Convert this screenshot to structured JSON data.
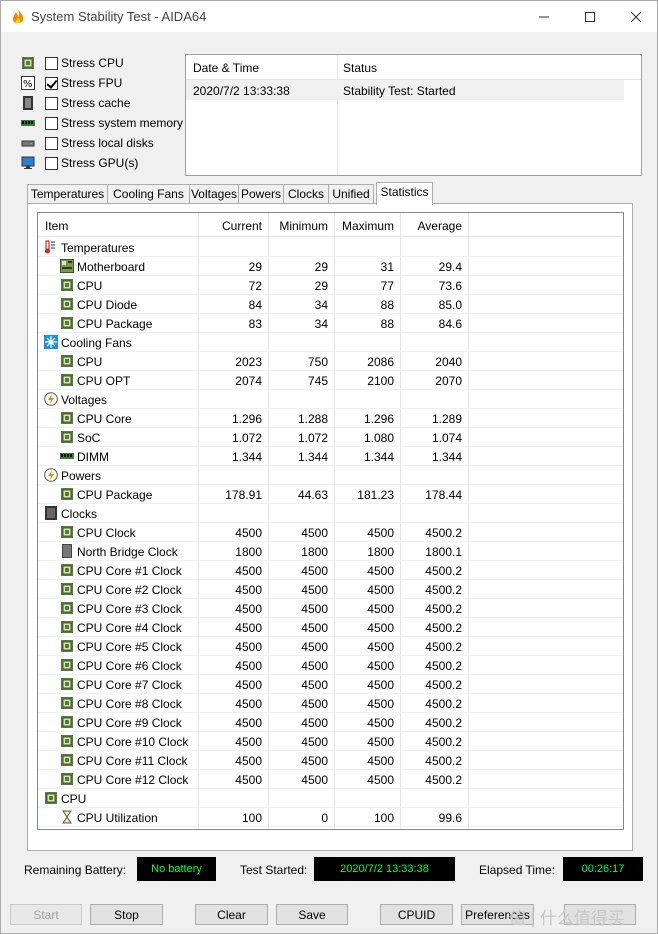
{
  "window": {
    "title": "System Stability Test - AIDA64",
    "controls": {
      "minimize": "—",
      "maximize": "☐",
      "close": "✕"
    }
  },
  "stress_options": [
    {
      "label": "Stress CPU",
      "checked": false,
      "icon": "cpu-chip-icon"
    },
    {
      "label": "Stress FPU",
      "checked": true,
      "icon": "fpu-icon"
    },
    {
      "label": "Stress cache",
      "checked": false,
      "icon": "cache-icon"
    },
    {
      "label": "Stress system memory",
      "checked": false,
      "icon": "memory-icon"
    },
    {
      "label": "Stress local disks",
      "checked": false,
      "icon": "disk-icon"
    },
    {
      "label": "Stress GPU(s)",
      "checked": false,
      "icon": "monitor-icon"
    }
  ],
  "status": {
    "headers": [
      "Date & Time",
      "Status"
    ],
    "rows": [
      [
        "2020/7/2 13:33:38",
        "Stability Test: Started"
      ]
    ]
  },
  "tabs": [
    "Temperatures",
    "Cooling Fans",
    "Voltages",
    "Powers",
    "Clocks",
    "Unified",
    "Statistics"
  ],
  "active_tab": "Statistics",
  "statistics": {
    "headers": [
      "Item",
      "Current",
      "Minimum",
      "Maximum",
      "Average"
    ],
    "rows": [
      {
        "type": "group",
        "name": "Temperatures",
        "icon": "thermometer-icon"
      },
      {
        "type": "item",
        "name": "Motherboard",
        "icon": "motherboard-icon",
        "cur": "29",
        "min": "29",
        "max": "31",
        "avg": "29.4"
      },
      {
        "type": "item",
        "name": "CPU",
        "icon": "cpu-chip-icon",
        "cur": "72",
        "min": "29",
        "max": "77",
        "avg": "73.6"
      },
      {
        "type": "item",
        "name": "CPU Diode",
        "icon": "cpu-chip-icon",
        "cur": "84",
        "min": "34",
        "max": "88",
        "avg": "85.0"
      },
      {
        "type": "item",
        "name": "CPU Package",
        "icon": "cpu-chip-icon",
        "cur": "83",
        "min": "34",
        "max": "88",
        "avg": "84.6"
      },
      {
        "type": "group",
        "name": "Cooling Fans",
        "icon": "fan-icon"
      },
      {
        "type": "item",
        "name": "CPU",
        "icon": "cpu-chip-icon",
        "cur": "2023",
        "min": "750",
        "max": "2086",
        "avg": "2040"
      },
      {
        "type": "item",
        "name": "CPU OPT",
        "icon": "cpu-chip-icon",
        "cur": "2074",
        "min": "745",
        "max": "2100",
        "avg": "2070"
      },
      {
        "type": "group",
        "name": "Voltages",
        "icon": "lightning-icon"
      },
      {
        "type": "item",
        "name": "CPU Core",
        "icon": "cpu-chip-icon",
        "cur": "1.296",
        "min": "1.288",
        "max": "1.296",
        "avg": "1.289"
      },
      {
        "type": "item",
        "name": "SoC",
        "icon": "cpu-chip-icon",
        "cur": "1.072",
        "min": "1.072",
        "max": "1.080",
        "avg": "1.074"
      },
      {
        "type": "item",
        "name": "DIMM",
        "icon": "memory-icon",
        "cur": "1.344",
        "min": "1.344",
        "max": "1.344",
        "avg": "1.344"
      },
      {
        "type": "group",
        "name": "Powers",
        "icon": "lightning-icon"
      },
      {
        "type": "item",
        "name": "CPU Package",
        "icon": "cpu-chip-icon",
        "cur": "178.91",
        "min": "44.63",
        "max": "181.23",
        "avg": "178.44"
      },
      {
        "type": "group",
        "name": "Clocks",
        "icon": "clock-chip-icon"
      },
      {
        "type": "item",
        "name": "CPU Clock",
        "icon": "cpu-chip-icon",
        "cur": "4500",
        "min": "4500",
        "max": "4500",
        "avg": "4500.2"
      },
      {
        "type": "item",
        "name": "North Bridge Clock",
        "icon": "northbridge-icon",
        "cur": "1800",
        "min": "1800",
        "max": "1800",
        "avg": "1800.1"
      },
      {
        "type": "item",
        "name": "CPU Core #1 Clock",
        "icon": "cpu-chip-icon",
        "cur": "4500",
        "min": "4500",
        "max": "4500",
        "avg": "4500.2"
      },
      {
        "type": "item",
        "name": "CPU Core #2 Clock",
        "icon": "cpu-chip-icon",
        "cur": "4500",
        "min": "4500",
        "max": "4500",
        "avg": "4500.2"
      },
      {
        "type": "item",
        "name": "CPU Core #3 Clock",
        "icon": "cpu-chip-icon",
        "cur": "4500",
        "min": "4500",
        "max": "4500",
        "avg": "4500.2"
      },
      {
        "type": "item",
        "name": "CPU Core #4 Clock",
        "icon": "cpu-chip-icon",
        "cur": "4500",
        "min": "4500",
        "max": "4500",
        "avg": "4500.2"
      },
      {
        "type": "item",
        "name": "CPU Core #5 Clock",
        "icon": "cpu-chip-icon",
        "cur": "4500",
        "min": "4500",
        "max": "4500",
        "avg": "4500.2"
      },
      {
        "type": "item",
        "name": "CPU Core #6 Clock",
        "icon": "cpu-chip-icon",
        "cur": "4500",
        "min": "4500",
        "max": "4500",
        "avg": "4500.2"
      },
      {
        "type": "item",
        "name": "CPU Core #7 Clock",
        "icon": "cpu-chip-icon",
        "cur": "4500",
        "min": "4500",
        "max": "4500",
        "avg": "4500.2"
      },
      {
        "type": "item",
        "name": "CPU Core #8 Clock",
        "icon": "cpu-chip-icon",
        "cur": "4500",
        "min": "4500",
        "max": "4500",
        "avg": "4500.2"
      },
      {
        "type": "item",
        "name": "CPU Core #9 Clock",
        "icon": "cpu-chip-icon",
        "cur": "4500",
        "min": "4500",
        "max": "4500",
        "avg": "4500.2"
      },
      {
        "type": "item",
        "name": "CPU Core #10 Clock",
        "icon": "cpu-chip-icon",
        "cur": "4500",
        "min": "4500",
        "max": "4500",
        "avg": "4500.2"
      },
      {
        "type": "item",
        "name": "CPU Core #11 Clock",
        "icon": "cpu-chip-icon",
        "cur": "4500",
        "min": "4500",
        "max": "4500",
        "avg": "4500.2"
      },
      {
        "type": "item",
        "name": "CPU Core #12 Clock",
        "icon": "cpu-chip-icon",
        "cur": "4500",
        "min": "4500",
        "max": "4500",
        "avg": "4500.2"
      },
      {
        "type": "group",
        "name": "CPU",
        "icon": "cpu-chip-icon"
      },
      {
        "type": "item",
        "name": "CPU Utilization",
        "icon": "hourglass-icon",
        "cur": "100",
        "min": "0",
        "max": "100",
        "avg": "99.6"
      }
    ]
  },
  "footer": {
    "remaining_battery_label": "Remaining Battery:",
    "remaining_battery_value": "No battery",
    "test_started_label": "Test Started:",
    "test_started_value": "2020/7/2 13:33:38",
    "elapsed_label": "Elapsed Time:",
    "elapsed_value": "00:26:17"
  },
  "buttons": {
    "start": "Start",
    "stop": "Stop",
    "clear": "Clear",
    "save": "Save",
    "cpuid": "CPUID",
    "preferences": "Preferences"
  },
  "watermark": "值 | 什么值得买",
  "colors": {
    "lcd_text": "#00ff40",
    "lcd_bg": "#000000"
  }
}
